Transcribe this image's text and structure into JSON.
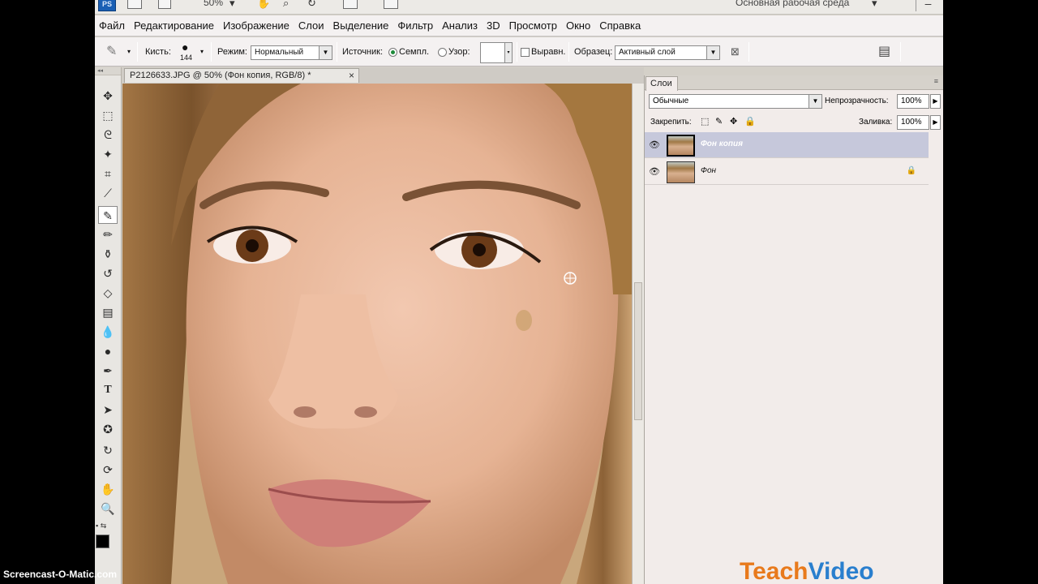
{
  "titlebar": {
    "logo": "PS",
    "zoom": "50%",
    "workspace": "Основная рабочая среда"
  },
  "menu": [
    "Файл",
    "Редактирование",
    "Изображение",
    "Слои",
    "Выделение",
    "Фильтр",
    "Анализ",
    "3D",
    "Просмотр",
    "Окно",
    "Справка"
  ],
  "options": {
    "brush_label": "Кисть:",
    "brush_size": "144",
    "mode_label": "Режим:",
    "mode_value": "Нормальный",
    "source_label": "Источник:",
    "source_sampled": "Семпл.",
    "source_pattern": "Узор:",
    "aligned": "Выравн.",
    "sample_label": "Образец:",
    "sample_value": "Активный слой"
  },
  "document": {
    "tab_title": "P2126633.JPG @ 50% (Фон копия, RGB/8) *",
    "close": "×"
  },
  "layers_panel": {
    "tab": "Слои",
    "blend_mode": "Обычные",
    "opacity_label": "Непрозрачность:",
    "opacity_value": "100%",
    "lock_label": "Закрепить:",
    "fill_label": "Заливка:",
    "fill_value": "100%",
    "layers": [
      {
        "name": "Фон копия",
        "selected": true
      },
      {
        "name": "Фон",
        "selected": false,
        "locked": true
      }
    ]
  },
  "watermarks": {
    "screencast": "Screencast-O-Matic.com",
    "teach": "Teach",
    "video": "Video"
  },
  "colors": {
    "accent": "#1a5fb4",
    "selected_layer": "#c6c8db",
    "teach_orange": "#e87a1c",
    "teach_blue": "#2a7fce"
  }
}
